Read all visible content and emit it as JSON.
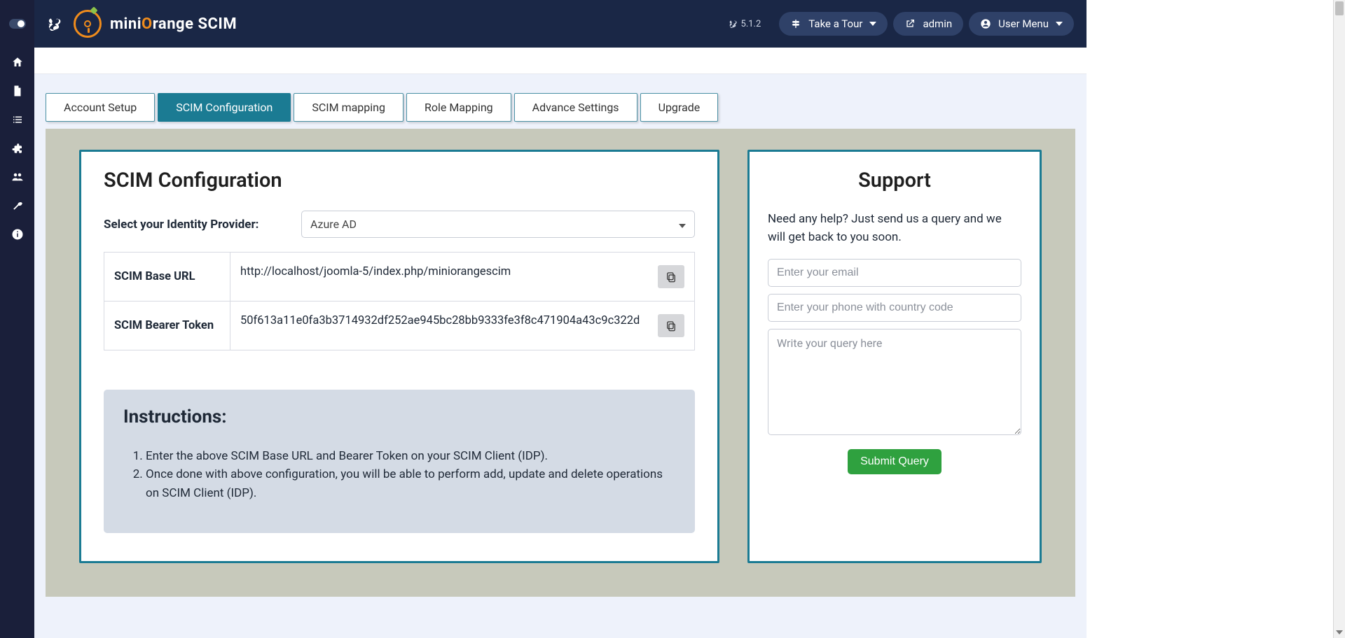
{
  "brand": {
    "prefix": "mini",
    "accent": "O",
    "suffix": "range SCIM"
  },
  "version": "5.1.2",
  "topbar": {
    "take_tour": "Take a Tour",
    "admin": "admin",
    "user_menu": "User Menu"
  },
  "sidebar": {
    "icons": [
      "home",
      "file",
      "list",
      "puzzle",
      "users",
      "wrench",
      "info"
    ]
  },
  "tabs": [
    {
      "label": "Account Setup",
      "active": false
    },
    {
      "label": "SCIM Configuration",
      "active": true
    },
    {
      "label": "SCIM mapping",
      "active": false
    },
    {
      "label": "Role Mapping",
      "active": false
    },
    {
      "label": "Advance Settings",
      "active": false
    },
    {
      "label": "Upgrade",
      "active": false
    }
  ],
  "config": {
    "title": "SCIM Configuration",
    "idp_label": "Select your Identity Provider:",
    "idp_value": "Azure AD",
    "rows": [
      {
        "key": "SCIM Base URL",
        "val": "http://localhost/joomla-5/index.php/miniorangescim"
      },
      {
        "key": "SCIM Bearer Token",
        "val": "50f613a11e0fa3b3714932df252ae945bc28bb9333fe3f8c471904a43c9c322d"
      }
    ]
  },
  "instructions": {
    "title": "Instructions:",
    "items": [
      "Enter the above SCIM Base URL and Bearer Token on your SCIM Client (IDP).",
      "Once done with above configuration, you will be able to perform add, update and delete operations on SCIM Client (IDP)."
    ]
  },
  "support": {
    "title": "Support",
    "text": "Need any help? Just send us a query and we will get back to you soon.",
    "email_ph": "Enter your email",
    "phone_ph": "Enter your phone with country code",
    "query_ph": "Write your query here",
    "submit": "Submit Query"
  }
}
